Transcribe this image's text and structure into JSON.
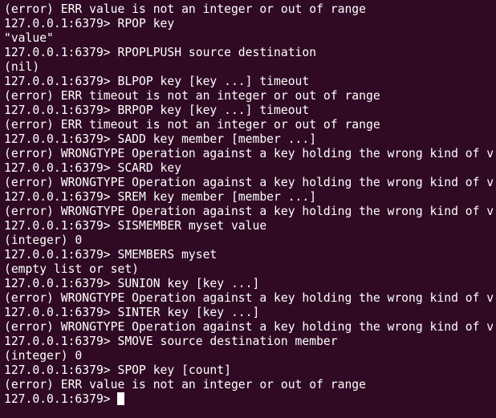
{
  "terminal": {
    "lines": [
      "(error) ERR value is not an integer or out of range",
      "127.0.0.1:6379> RPOP key",
      "\"value\"",
      "127.0.0.1:6379> RPOPLPUSH source destination",
      "(nil)",
      "127.0.0.1:6379> BLPOP key [key ...] timeout",
      "(error) ERR timeout is not an integer or out of range",
      "127.0.0.1:6379> BRPOP key [key ...] timeout",
      "(error) ERR timeout is not an integer or out of range",
      "127.0.0.1:6379> SADD key member [member ...]",
      "(error) WRONGTYPE Operation against a key holding the wrong kind of v",
      "127.0.0.1:6379> SCARD key",
      "(error) WRONGTYPE Operation against a key holding the wrong kind of v",
      "127.0.0.1:6379> SREM key member [member ...]",
      "(error) WRONGTYPE Operation against a key holding the wrong kind of v",
      "127.0.0.1:6379> SISMEMBER myset value",
      "(integer) 0",
      "127.0.0.1:6379> SMEMBERS myset",
      "(empty list or set)",
      "127.0.0.1:6379> SUNION key [key ...]",
      "(error) WRONGTYPE Operation against a key holding the wrong kind of v",
      "127.0.0.1:6379> SINTER key [key ...]",
      "(error) WRONGTYPE Operation against a key holding the wrong kind of v",
      "127.0.0.1:6379> SMOVE source destination member",
      "(integer) 0",
      "127.0.0.1:6379> SPOP key [count]",
      "(error) ERR value is not an integer or out of range"
    ],
    "prompt": "127.0.0.1:6379> ",
    "colors": {
      "background": "#300a24",
      "foreground": "#ffffff"
    }
  }
}
